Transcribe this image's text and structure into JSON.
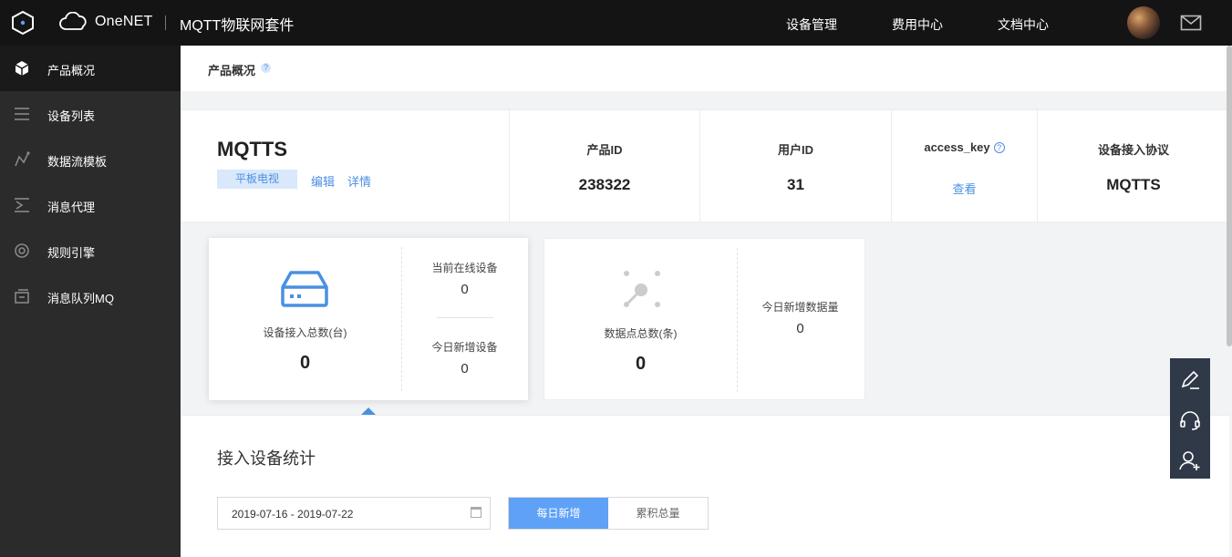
{
  "topbar": {
    "brand": "OneNET",
    "suite": "MQTT物联网套件",
    "nav": [
      "设备管理",
      "费用中心",
      "文档中心"
    ]
  },
  "sidebar": {
    "items": [
      {
        "label": "产品概况",
        "icon": "cube-icon"
      },
      {
        "label": "设备列表",
        "icon": "list-icon"
      },
      {
        "label": "数据流模板",
        "icon": "graph-icon"
      },
      {
        "label": "消息代理",
        "icon": "broker-icon"
      },
      {
        "label": "规则引擎",
        "icon": "target-icon"
      },
      {
        "label": "消息队列MQ",
        "icon": "queue-icon"
      }
    ]
  },
  "page": {
    "title": "产品概况",
    "help": "?"
  },
  "product": {
    "name": "MQTTS",
    "tag": "平板电视",
    "edit": "编辑",
    "detail": "详情",
    "fields": [
      {
        "key": "产品ID",
        "value": "238322"
      },
      {
        "key": "用户ID",
        "value": "31"
      },
      {
        "key": "access_key",
        "help": "?",
        "link": "查看"
      },
      {
        "key": "设备接入协议",
        "value": "MQTTS"
      }
    ]
  },
  "cards": {
    "devices": {
      "label": "设备接入总数(台)",
      "value": "0",
      "online_label": "当前在线设备",
      "online_value": "0",
      "new_label": "今日新增设备",
      "new_value": "0"
    },
    "datapoints": {
      "label": "数据点总数(条)",
      "value": "0",
      "new_label": "今日新增数据量",
      "new_value": "0"
    }
  },
  "stats": {
    "heading": "接入设备统计",
    "date_range": "2019-07-16 - 2019-07-22",
    "tab_daily": "每日新增",
    "tab_total": "累积总量"
  },
  "colors": {
    "accent": "#4a90e2",
    "topbar": "#141414",
    "sidebar": "#2b2b2b"
  }
}
